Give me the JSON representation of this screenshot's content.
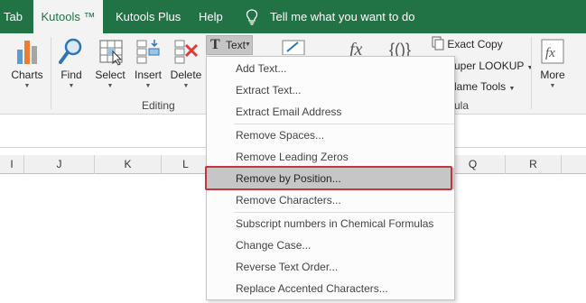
{
  "tabs": [
    {
      "label": "Tab",
      "active": false
    },
    {
      "label": "Kutools ™",
      "active": true
    },
    {
      "label": "Kutools Plus",
      "active": false
    },
    {
      "label": "Help",
      "active": false
    }
  ],
  "tell_me": "Tell me what you want to do",
  "ribbon": {
    "charts": "Charts",
    "find": "Find",
    "select": "Select",
    "insert": "Insert",
    "delete": "Delete",
    "editing_group": "Editing",
    "text_button": "Text",
    "exact_copy": "Exact Copy",
    "super_lookup": "uper LOOKUP",
    "name_tools": "lame Tools",
    "more": "More",
    "formula_group_partial": "ula"
  },
  "columns": [
    "I",
    "J",
    "K",
    "L",
    "Q",
    "R"
  ],
  "text_menu": {
    "items": [
      "Add Text...",
      "Extract Text...",
      "Extract Email Address",
      "Remove Spaces...",
      "Remove Leading Zeros",
      "Remove by Position...",
      "Remove Characters...",
      "Subscript numbers in Chemical Formulas",
      "Change Case...",
      "Reverse Text Order...",
      "Replace Accented Characters..."
    ],
    "selected": "Remove by Position..."
  },
  "colors": {
    "tab_bar": "#217346",
    "ribbon_bg": "#f3f3f3",
    "selected_item_bg": "#c6c6c6",
    "highlight_border": "#c9343c"
  }
}
